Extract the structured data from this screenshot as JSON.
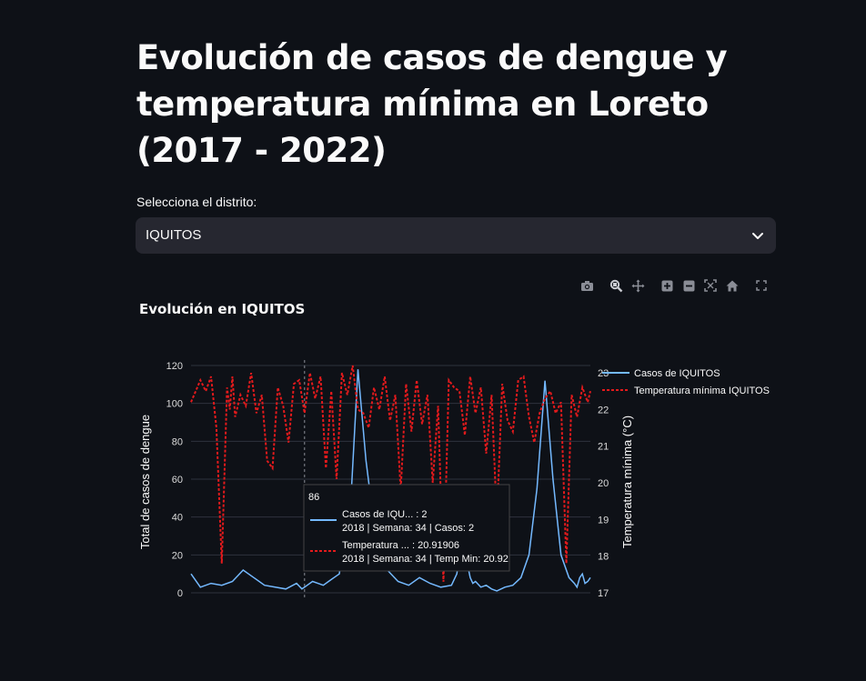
{
  "page": {
    "title": "Evolución de casos de dengue y temperatura mínima en Loreto (2017 - 2022)",
    "select_label": "Selecciona el distrito:",
    "select_value": "IQUITOS"
  },
  "modebar": {
    "icons": [
      "camera-icon",
      "zoom-icon",
      "pan-icon",
      "zoom-in-icon",
      "zoom-out-icon",
      "autoscale-icon",
      "home-icon",
      "fullscreen-icon"
    ]
  },
  "chart_title": "Evolución en IQUITOS",
  "colors": {
    "cases": "#74b9ff",
    "temp": "#e31a1c",
    "grid": "#2f333d",
    "background": "#0e1117"
  },
  "chart_data": {
    "type": "line",
    "title": "Evolución en IQUITOS",
    "y_left_label": "Total de casos de dengue",
    "y_right_label": "Temperatura mínima (°C)",
    "y_left_ticks": [
      "0",
      "20",
      "40",
      "60",
      "80",
      "100",
      "120"
    ],
    "y_right_ticks": [
      "17",
      "18",
      "19",
      "20",
      "21",
      "22",
      "23"
    ],
    "y_left_range": [
      0,
      120
    ],
    "y_right_range": [
      17,
      23.2
    ],
    "x_range": [
      1,
      300
    ],
    "legend": [
      "Casos de IQUITOS",
      "Temperatura mínima IQUITOS"
    ],
    "legend_position": "top-right",
    "series": [
      {
        "name": "Casos de IQUITOS",
        "axis": "left",
        "style": "solid",
        "x": [
          1,
          8,
          16,
          24,
          32,
          40,
          48,
          56,
          64,
          72,
          80,
          84,
          86,
          88,
          92,
          96,
          100,
          104,
          108,
          112,
          116,
          120,
          126,
          132,
          140,
          148,
          156,
          164,
          172,
          180,
          188,
          196,
          200,
          204,
          206,
          208,
          210,
          212,
          214,
          218,
          222,
          226,
          230,
          236,
          242,
          248,
          254,
          260,
          266,
          272,
          278,
          284,
          288,
          290,
          292,
          294,
          296,
          298,
          300
        ],
        "values": [
          10,
          3,
          5,
          4,
          6,
          12,
          8,
          4,
          3,
          2,
          5,
          2,
          3,
          4,
          6,
          5,
          4,
          6,
          8,
          10,
          30,
          40,
          118,
          70,
          25,
          12,
          6,
          4,
          8,
          5,
          3,
          4,
          10,
          30,
          20,
          15,
          8,
          5,
          6,
          3,
          4,
          2,
          1,
          3,
          4,
          8,
          20,
          55,
          112,
          60,
          20,
          8,
          5,
          3,
          8,
          10,
          5,
          6,
          8
        ]
      },
      {
        "name": "Temperatura mínima IQUITOS",
        "axis": "right",
        "style": "dotted",
        "x": [
          1,
          8,
          12,
          16,
          20,
          24,
          28,
          30,
          32,
          34,
          38,
          42,
          46,
          50,
          54,
          58,
          62,
          66,
          70,
          74,
          78,
          82,
          86,
          90,
          94,
          98,
          102,
          106,
          110,
          114,
          118,
          122,
          126,
          130,
          134,
          138,
          142,
          146,
          150,
          154,
          158,
          162,
          166,
          170,
          174,
          178,
          182,
          186,
          190,
          194,
          198,
          202,
          206,
          210,
          214,
          218,
          222,
          226,
          230,
          234,
          238,
          242,
          246,
          250,
          254,
          258,
          262,
          266,
          270,
          274,
          278,
          282,
          286,
          290,
          294,
          298,
          300
        ],
        "values": [
          22.2,
          22.8,
          22.5,
          22.9,
          21.5,
          17.8,
          22.6,
          22.0,
          22.9,
          21.8,
          22.4,
          22.1,
          23.0,
          21.9,
          22.4,
          20.6,
          20.4,
          22.6,
          22.1,
          21.1,
          22.7,
          22.8,
          21.9,
          23.0,
          22.3,
          22.9,
          20.4,
          22.5,
          20.1,
          23.0,
          22.4,
          23.2,
          22.0,
          21.9,
          21.5,
          22.6,
          22.0,
          22.9,
          21.7,
          22.4,
          19.8,
          22.7,
          21.4,
          22.8,
          21.6,
          22.4,
          20.0,
          22.1,
          17.3,
          22.8,
          22.6,
          22.5,
          21.3,
          22.9,
          21.9,
          22.6,
          20.8,
          22.4,
          19.0,
          22.7,
          21.7,
          21.4,
          22.8,
          22.9,
          21.8,
          21.1,
          21.9,
          22.3,
          22.5,
          21.9,
          22.2,
          17.8,
          22.4,
          21.8,
          22.6,
          22.2,
          22.5
        ]
      }
    ],
    "hover": {
      "x_value": 86,
      "x_label": "86",
      "lines": [
        {
          "series": "cases",
          "name_line": "Casos de IQU... : 2",
          "detail_line": "2018 | Semana: 34 | Casos: 2"
        },
        {
          "series": "temp",
          "name_line": "Temperatura ... : 20.91906",
          "detail_line": "2018 | Semana: 34 | Temp Min: 20.92"
        }
      ]
    }
  }
}
